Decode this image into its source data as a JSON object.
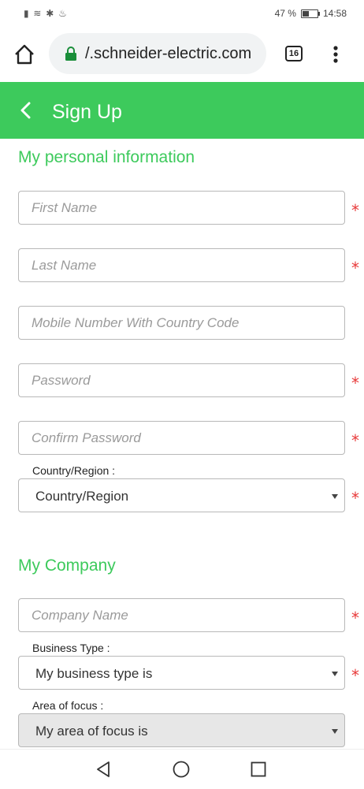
{
  "status_bar": {
    "battery_text": "47 %",
    "battery_level": 0.47,
    "time": "14:58"
  },
  "browser": {
    "url": "/.schneider-electric.com",
    "tab_count": "16"
  },
  "header": {
    "title": "Sign Up"
  },
  "personal": {
    "title": "My personal information",
    "first_name_placeholder": "First Name",
    "last_name_placeholder": "Last Name",
    "mobile_placeholder": "Mobile Number With Country Code",
    "password_placeholder": "Password",
    "confirm_password_placeholder": "Confirm Password",
    "country_label": "Country/Region :",
    "country_value": "Country/Region",
    "required_mark": "*"
  },
  "company": {
    "title": "My Company",
    "company_name_placeholder": "Company Name",
    "business_type_label": "Business Type :",
    "business_type_value": "My business type is",
    "area_label": "Area of focus :",
    "area_value": "My area of focus is"
  },
  "colors": {
    "brand_green": "#3dca5c",
    "required_red": "#e83a3a"
  }
}
